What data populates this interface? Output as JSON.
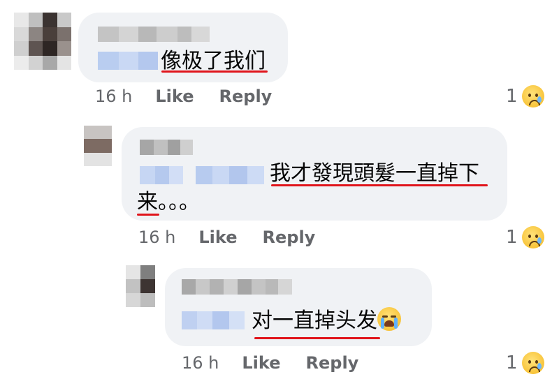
{
  "comments": [
    {
      "text": "像极了我们",
      "time": "16 h",
      "like_label": "Like",
      "reply_label": "Reply",
      "reaction_count": "1",
      "reaction_icon": "sad-crying-face"
    },
    {
      "text_line1": "我才發現頭髮一直掉下",
      "text_line2": "来。。。",
      "time": "16 h",
      "like_label": "Like",
      "reply_label": "Reply",
      "reaction_count": "1",
      "reaction_icon": "sad-crying-face"
    },
    {
      "text": "对一直掉头发",
      "emoji": "loudly-crying-face",
      "time": "16 h",
      "like_label": "Like",
      "reply_label": "Reply",
      "reaction_count": "1",
      "reaction_icon": "sad-crying-face"
    }
  ],
  "colors": {
    "bubble": "#f0f2f5",
    "meta_text": "#65676b",
    "underline": "#e0141b",
    "pixelated_name": "#b9b9b9",
    "pixelated_mention": "#bcd0f2"
  }
}
